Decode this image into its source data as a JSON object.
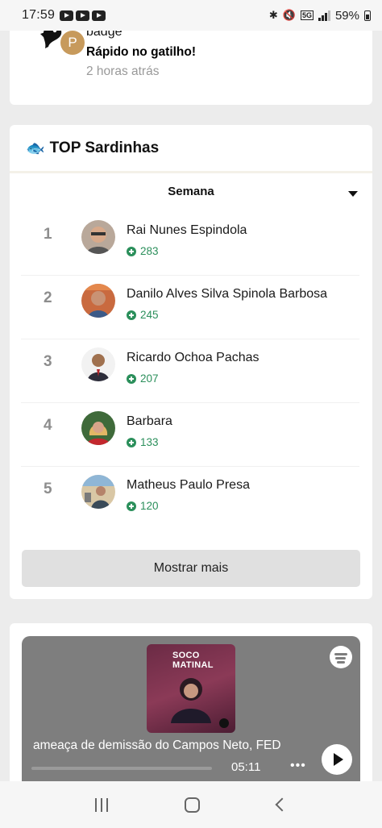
{
  "status_bar": {
    "time": "17:59",
    "battery": "59%"
  },
  "badge_card": {
    "avatar_letter": "P",
    "title": "badge",
    "name": "Rápido no gatilho!",
    "time": "2 horas atrás"
  },
  "top_sardinhas": {
    "title": "TOP Sardinhas",
    "period": "Semana",
    "ranking": [
      {
        "rank": "1",
        "name": "Rai Nunes Espindola",
        "points": "283"
      },
      {
        "rank": "2",
        "name": "Danilo Alves Silva Spinola Barbosa",
        "points": "245"
      },
      {
        "rank": "3",
        "name": "Ricardo Ochoa Pachas",
        "points": "207"
      },
      {
        "rank": "4",
        "name": "Barbara",
        "points": "133"
      },
      {
        "rank": "5",
        "name": "Matheus Paulo Presa",
        "points": "120"
      }
    ],
    "more_label": "Mostrar mais"
  },
  "podcast": {
    "cover_title": "SOCO MATINAL",
    "episode_title": "ameaça de demissão do Campos Neto, FED",
    "duration": "05:11"
  },
  "colors": {
    "points_green": "#2b8f5b",
    "player_bg": "#7e7e7e",
    "button_bg": "#e0e0e0"
  }
}
